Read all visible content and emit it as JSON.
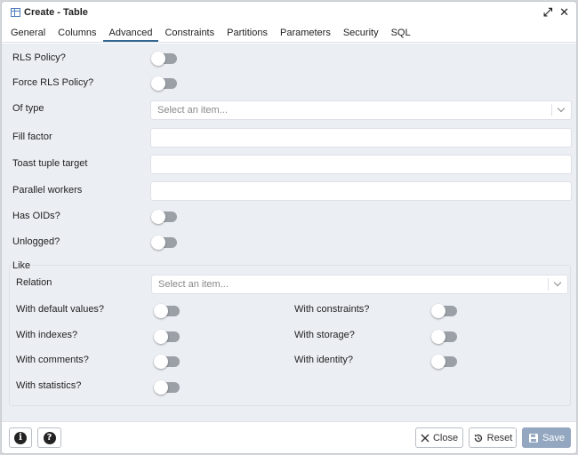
{
  "window": {
    "title": "Create - Table",
    "expand_glyph": "⤢",
    "close_glyph": "✕"
  },
  "tabs": [
    "General",
    "Columns",
    "Advanced",
    "Constraints",
    "Partitions",
    "Parameters",
    "Security",
    "SQL"
  ],
  "active_tab": "Advanced",
  "fields": {
    "rls_policy": {
      "label": "RLS Policy?",
      "checked": false
    },
    "force_rls_policy": {
      "label": "Force RLS Policy?",
      "checked": false
    },
    "of_type": {
      "label": "Of type",
      "placeholder": "Select an item..."
    },
    "fill_factor": {
      "label": "Fill factor",
      "value": ""
    },
    "toast_tuple_target": {
      "label": "Toast tuple target",
      "value": ""
    },
    "parallel_workers": {
      "label": "Parallel workers",
      "value": ""
    },
    "has_oids": {
      "label": "Has OIDs?",
      "checked": false
    },
    "unlogged": {
      "label": "Unlogged?",
      "checked": false
    }
  },
  "like": {
    "legend": "Like",
    "relation": {
      "label": "Relation",
      "placeholder": "Select an item..."
    },
    "with_default_values": {
      "label": "With default values?",
      "checked": false
    },
    "with_constraints": {
      "label": "With constraints?",
      "checked": false
    },
    "with_indexes": {
      "label": "With indexes?",
      "checked": false
    },
    "with_storage": {
      "label": "With storage?",
      "checked": false
    },
    "with_comments": {
      "label": "With comments?",
      "checked": false
    },
    "with_identity": {
      "label": "With identity?",
      "checked": false
    },
    "with_statistics": {
      "label": "With statistics?",
      "checked": false
    }
  },
  "footer": {
    "info_glyph": "i",
    "help_glyph": "?",
    "close_label": "Close",
    "reset_label": "Reset",
    "save_label": "Save"
  },
  "colors": {
    "accent": "#326690",
    "save_disabled": "#93a7c0",
    "panel_bg": "#ebeef3",
    "toggle_off": "#9aa0a6"
  }
}
